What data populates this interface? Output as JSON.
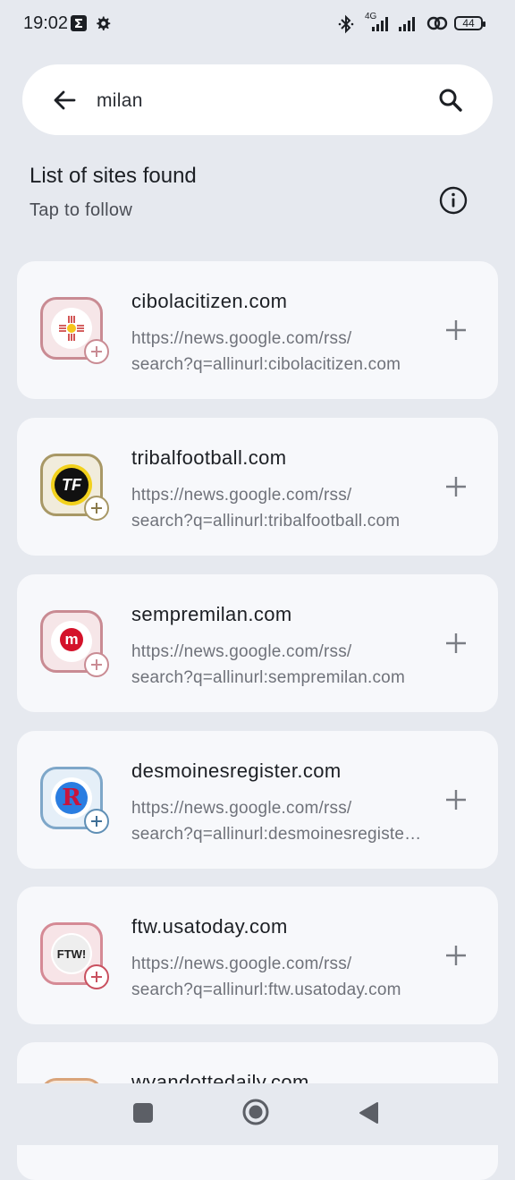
{
  "status_bar": {
    "time": "19:02",
    "network": "4G",
    "battery": "44"
  },
  "search": {
    "query": "milan"
  },
  "section": {
    "title": "List of sites found",
    "subtitle": "Tap to follow"
  },
  "sites": [
    {
      "name": "cibolacitizen.com",
      "url_line1": "https://news.google.com/rss/",
      "url_line2": "search?q=allinurl:cibolacitizen.com",
      "accent": "#c98b93",
      "tint": "#f6e6e8"
    },
    {
      "name": "tribalfootball.com",
      "url_line1": "https://news.google.com/rss/",
      "url_line2": "search?q=allinurl:tribalfootball.com",
      "accent": "#a89866",
      "tint": "#f1ecdc"
    },
    {
      "name": "sempremilan.com",
      "url_line1": "https://news.google.com/rss/",
      "url_line2": "search?q=allinurl:sempremilan.com",
      "accent": "#c98b93",
      "tint": "#f6e6e8"
    },
    {
      "name": "desmoinesregister.com",
      "url_line1": "https://news.google.com/rss/",
      "url_line2": "search?q=allinurl:desmoinesregister.com",
      "accent": "#7ea7c9",
      "tint": "#e5eff8"
    },
    {
      "name": "ftw.usatoday.com",
      "url_line1": "https://news.google.com/rss/",
      "url_line2": "search?q=allinurl:ftw.usatoday.com",
      "accent": "#d58a95",
      "tint": "#f7e4e7"
    },
    {
      "name": "wyandottedaily.com"
    }
  ],
  "logos": {
    "tribalfootball": "TF",
    "sempremilan": "m",
    "desmoinesregister": "R",
    "ftw": "FTW!"
  }
}
